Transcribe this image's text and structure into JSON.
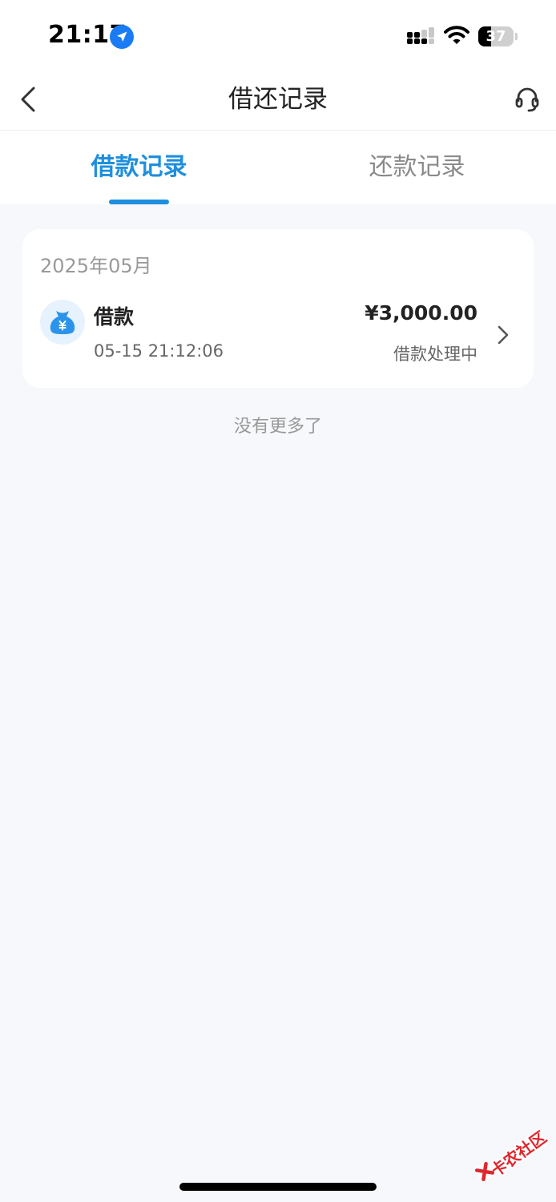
{
  "status_bar": {
    "time": "21:17",
    "battery_level": "37",
    "battery_fraction": 0.37,
    "location_icon": "location-arrow-icon",
    "signal_icon": "cellular-signal-icon",
    "wifi_icon": "wifi-icon"
  },
  "nav": {
    "title": "借还记录",
    "back_icon": "chevron-left-icon",
    "service_icon": "headset-icon"
  },
  "tabs": [
    {
      "label": "借款记录",
      "active": true
    },
    {
      "label": "还款记录",
      "active": false
    }
  ],
  "records": {
    "month": "2025年05月",
    "items": [
      {
        "type": "借款",
        "datetime": "05-15 21:12:06",
        "amount": "¥3,000.00",
        "status": "借款处理中",
        "icon": "money-bag-icon"
      }
    ]
  },
  "footer": {
    "no_more": "没有更多了"
  },
  "watermark": {
    "text": "卡农社区"
  },
  "colors": {
    "accent": "#1f8fdd",
    "background": "#f6f8fc",
    "card": "#ffffff",
    "muted_text": "#999999",
    "watermark": "#e0262e"
  }
}
